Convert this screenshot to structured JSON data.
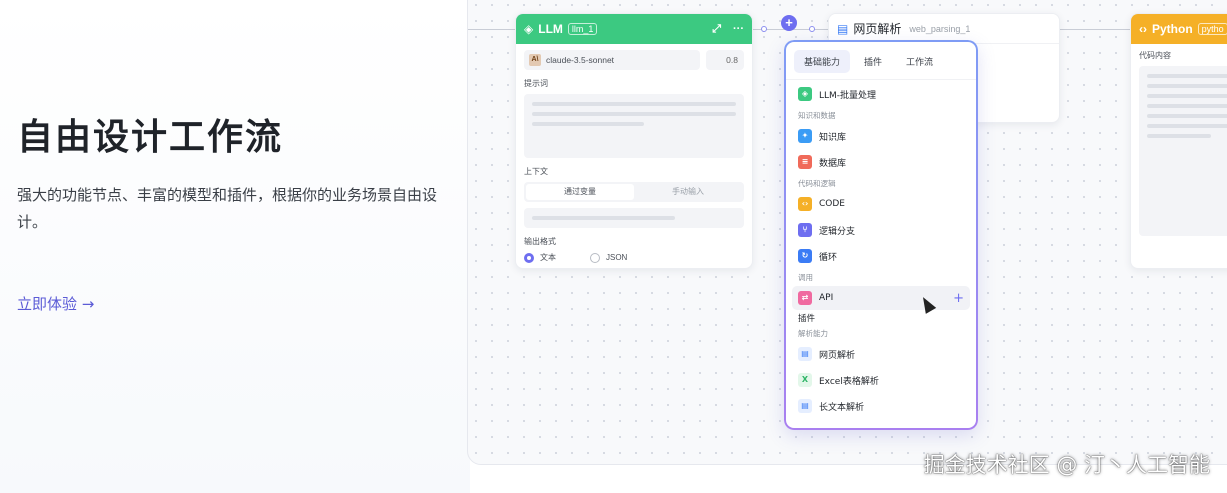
{
  "hero": {
    "title": "自由设计工作流",
    "description": "强大的功能节点、丰富的模型和插件，根据你的业务场景自由设计。",
    "cta": "立即体验 →"
  },
  "llm_node": {
    "title": "LLM",
    "tag": "llm_1",
    "model": "claude-3.5-sonnet",
    "model_logo": "A\\",
    "temperature": "0.8",
    "prompt_label": "提示词",
    "context_label": "上下文",
    "context_tabs": [
      "通过变量",
      "手动输入"
    ],
    "output_label": "输出格式",
    "output_options": [
      "文本",
      "JSON"
    ]
  },
  "web_node": {
    "title": "网页解析",
    "tag": "web_parsing_1"
  },
  "python_node": {
    "title": "Python",
    "tag": "pytho",
    "code_label": "代码内容"
  },
  "picker": {
    "tabs": [
      "基础能力",
      "插件",
      "工作流"
    ],
    "items": [
      {
        "label": "LLM-批量处理",
        "color": "#3cc981",
        "icon": "llm-icon"
      },
      {
        "group": "知识和数据"
      },
      {
        "label": "知识库",
        "color": "#3b9cf5",
        "icon": "knowledge-icon"
      },
      {
        "label": "数据库",
        "color": "#f06a5a",
        "icon": "database-icon"
      },
      {
        "group": "代码和逻辑"
      },
      {
        "label": "CODE",
        "color": "#f5b027",
        "icon": "code-icon"
      },
      {
        "label": "逻辑分支",
        "color": "#6e6ef0",
        "icon": "branch-icon"
      },
      {
        "label": "循环",
        "color": "#3b7cf5",
        "icon": "loop-icon"
      },
      {
        "group": "调用"
      },
      {
        "label": "API",
        "color": "#f06aa0",
        "icon": "api-icon",
        "hover": true
      },
      {
        "group": "插件",
        "bold": true
      },
      {
        "group": "解析能力"
      },
      {
        "label": "网页解析",
        "color": "#e5eeff",
        "icon": "web-parse-icon"
      },
      {
        "label": "Excel表格解析",
        "color": "#e3f7ea",
        "icon": "excel-icon"
      },
      {
        "label": "长文本解析",
        "color": "#e5eeff",
        "icon": "long-text-icon"
      }
    ]
  },
  "watermark": "掘金技术社区 @ 汀丶人工智能"
}
